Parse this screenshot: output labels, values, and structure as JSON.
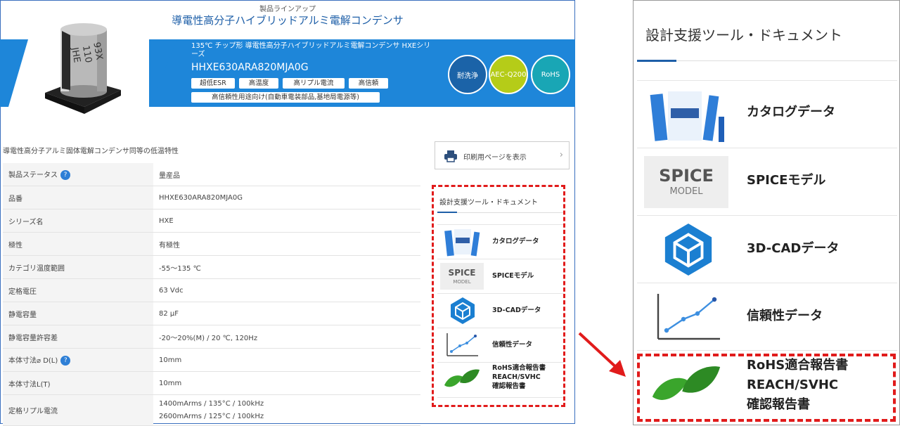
{
  "header": {
    "breadcrumb": "製品ラインアップ",
    "title": "導電性高分子ハイブリッドアルミ電解コンデンサ",
    "capacitor_marking": [
      "93X",
      "110",
      "JHE"
    ]
  },
  "banner": {
    "subtitle": "135℃ チップ形 導電性高分子ハイブリッドアルミ電解コンデンサ HXEシリーズ",
    "part_number": "HHXE630ARA820MJA0G",
    "features": [
      "超低ESR",
      "高温度",
      "高リプル電流",
      "高信頼",
      "高信頼性用途向け(自動車電装部品,基地局電源等)"
    ],
    "badges": [
      {
        "label": "耐洗浄",
        "color": "#1b63a8"
      },
      {
        "label": "AEC-Q200",
        "color": "#b5cc18"
      },
      {
        "label": "RoHS",
        "color": "#19a6b5"
      }
    ]
  },
  "note": "導電性高分子アルミ固体電解コンデンサ同等の低温特性",
  "specs": [
    {
      "key": "製品ステータス",
      "value": "量産品",
      "help": true
    },
    {
      "key": "品番",
      "value": "HHXE630ARA820MJA0G"
    },
    {
      "key": "シリーズ名",
      "value": "HXE"
    },
    {
      "key": "極性",
      "value": "有極性"
    },
    {
      "key": "カテゴリ温度範囲",
      "value": "-55～135 ℃"
    },
    {
      "key": "定格電圧",
      "value": "63 Vdc"
    },
    {
      "key": "静電容量",
      "value": "82 μF"
    },
    {
      "key": "静電容量許容差",
      "value": "-20～20%(M) / 20 ℃, 120Hz"
    },
    {
      "key": "本体寸法⌀ D(L)",
      "value": "10mm",
      "help": true
    },
    {
      "key": "本体寸法L(T)",
      "value": "10mm"
    },
    {
      "key": "定格リプル電流",
      "value": "1400mArms / 135°C / 100kHz",
      "value2": "2600mArms / 125°C / 100kHz"
    }
  ],
  "help_mark": "?",
  "print_button": "印刷用ページを表示",
  "print_arrow": "›",
  "tools": {
    "title": "設計支援ツール・ドキュメント",
    "items": [
      {
        "label": "カタログデータ",
        "icon": "catalog-icon"
      },
      {
        "label": "SPICEモデル",
        "icon": "spice-model-icon",
        "icon_text": [
          "SPICE",
          "MODEL"
        ]
      },
      {
        "label": "3D-CADデータ",
        "icon": "3d-cad-icon"
      },
      {
        "label": "信頼性データ",
        "icon": "reliability-chart-icon"
      },
      {
        "label_lines": [
          "RoHS適合報告書",
          "REACH/SVHC",
          "確認報告書"
        ],
        "icon": "leaf-icon"
      }
    ]
  },
  "colors": {
    "accent": "#1e86d9",
    "highlight": "#e11b1b",
    "title_blue": "#1e5fa8"
  }
}
